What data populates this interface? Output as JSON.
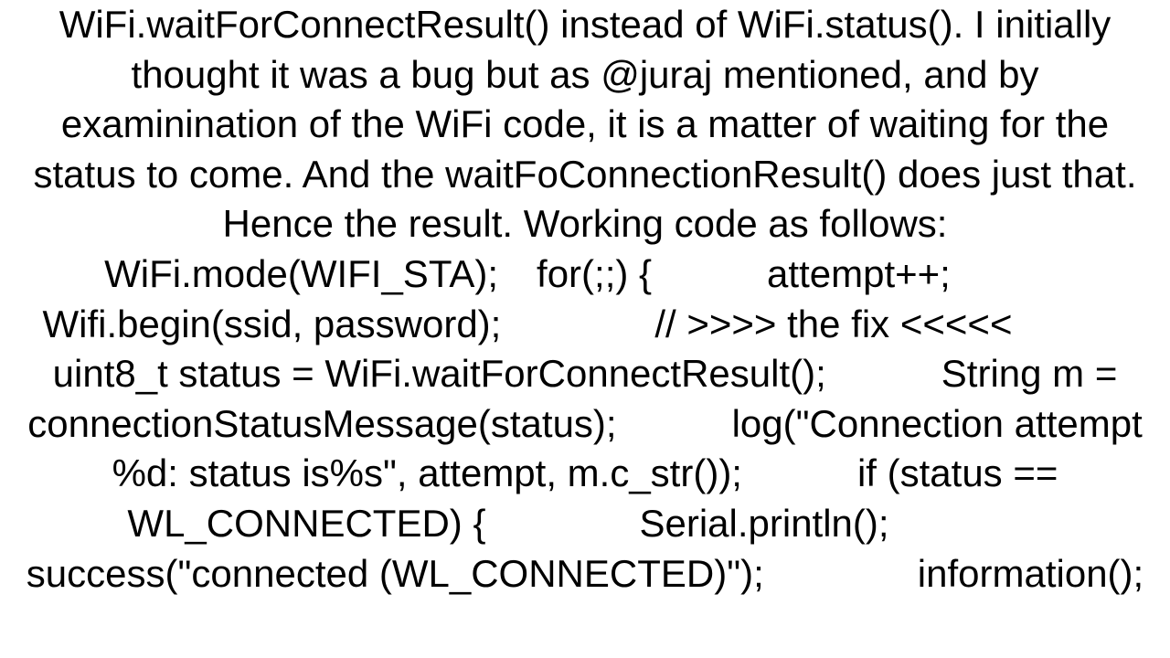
{
  "paragraph": "WiFi.waitForConnectResult() instead of WiFi.status(). I initially thought it was a bug but as @juraj mentioned, and by examinination of the WiFi code, it is a matter of waiting for the status to come. And the waitFoConnectionResult() does just that. Hence the result. Working code as follows: WiFi.mode(WIFI_STA); for(;;) {   attempt++;   Wifi.begin(ssid, password);    // >>>> the fix <<<<<   uint8_t status = WiFi.waitForConnectResult();   String m = connectionStatusMessage(status);   log(\"Connection attempt %d: status is%s\", attempt, m.c_str());   if (status == WL_CONNECTED) {    Serial.println();    success(\"connected (WL_CONNECTED)\");    information();"
}
